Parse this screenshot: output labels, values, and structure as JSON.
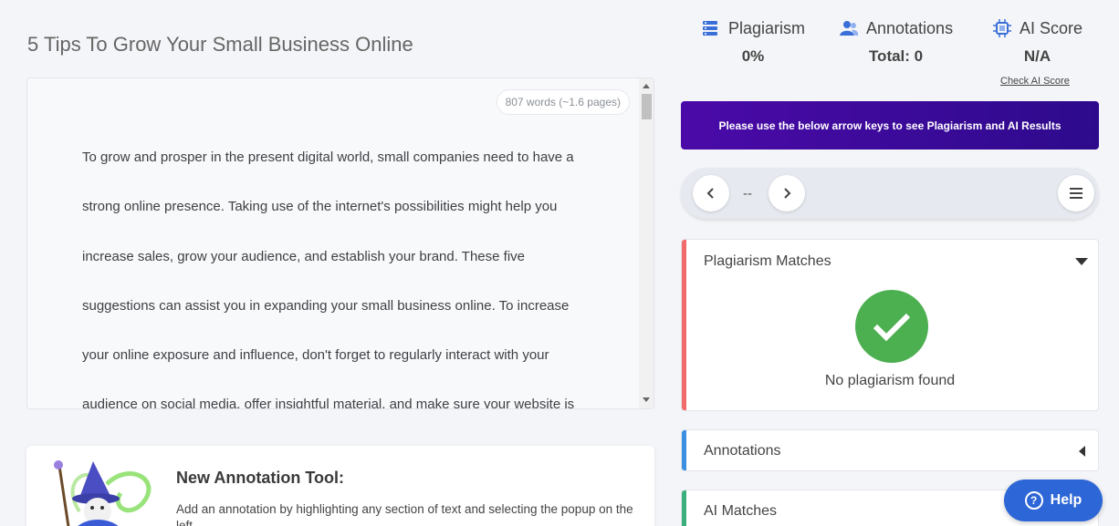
{
  "document": {
    "title": "5 Tips To Grow Your Small Business Online",
    "word_count": "807 words (~1.6 pages)",
    "lines": [
      "To grow and prosper in the present digital world, small companies need to have a",
      "strong online presence. Taking use of the internet's possibilities might help you",
      "increase sales, grow your audience, and establish your brand. These five",
      "suggestions can assist you in expanding your small business online. To increase",
      "your online exposure and influence, don't forget to regularly interact with your",
      "audience on social media, offer insightful material, and make sure your website is"
    ]
  },
  "annotation_card": {
    "title": "New Annotation Tool:",
    "description": "Add an annotation by highlighting any section of text and selecting the popup on the left."
  },
  "stats": {
    "plagiarism": {
      "label": "Plagiarism",
      "value": "0%",
      "icon": "server-icon"
    },
    "annotations": {
      "label": "Annotations",
      "value": "Total: 0",
      "icon": "users-icon"
    },
    "ai_score": {
      "label": "AI Score",
      "value": "N/A",
      "icon": "chip-icon",
      "link": "Check AI Score"
    }
  },
  "banner": {
    "text": "Please use the below arrow keys to see Plagiarism and AI Results"
  },
  "navigator": {
    "counter": "--"
  },
  "panels": {
    "plagiarism": {
      "title": "Plagiarism Matches",
      "message": "No plagiarism found",
      "accent": "#f26b6b"
    },
    "annotations": {
      "title": "Annotations",
      "accent": "#3b8fe0"
    },
    "ai": {
      "title": "AI Matches",
      "accent": "#3cb07c"
    }
  },
  "help": {
    "label": "Help"
  }
}
